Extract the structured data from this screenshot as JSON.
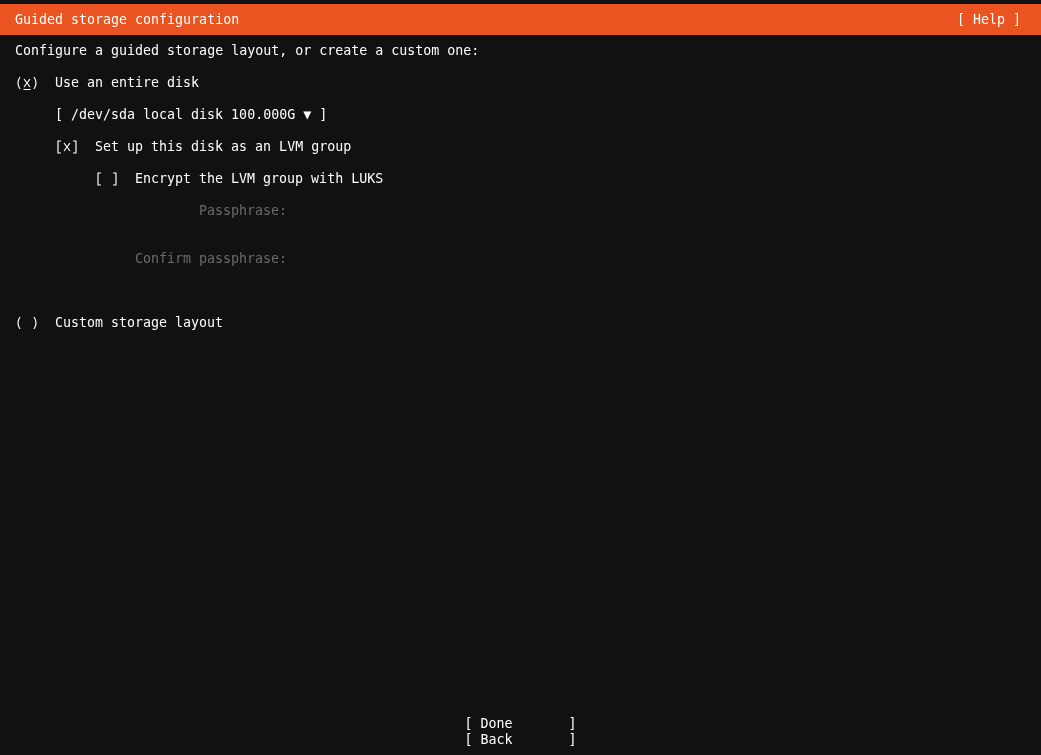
{
  "header": {
    "title": "Guided storage configuration",
    "help": "[ Help ]"
  },
  "intro": "Configure a guided storage layout, or create a custom one:",
  "options": [
    {
      "label": "Use an entire disk",
      "selected": true,
      "disk": "[ /dev/sda local disk 100.000G ▼ ]",
      "lvm": {
        "label": "Set up this disk as an LVM group",
        "checked": true,
        "encrypt": {
          "label": "Encrypt the LVM group with LUKS",
          "checked": false,
          "fields": [
            {
              "label": "Passphrase:",
              "disabled": true
            },
            {
              "label": "Confirm passphrase:",
              "disabled": true
            }
          ]
        }
      }
    },
    {
      "label": "Custom storage layout",
      "selected": false
    }
  ],
  "buttons": [
    "[ Done       ]",
    "[ Back       ]"
  ]
}
